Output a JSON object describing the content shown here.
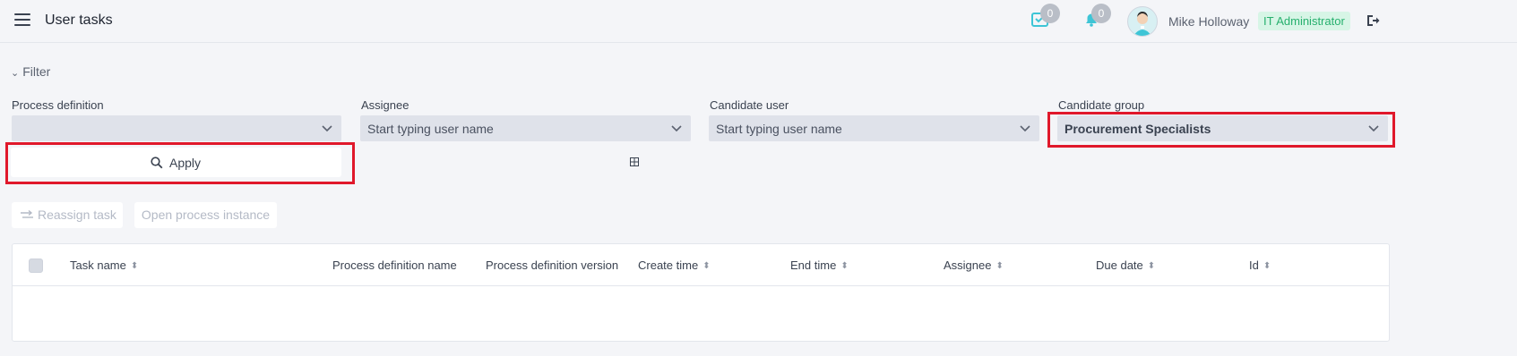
{
  "header": {
    "title": "User tasks",
    "tasks_count": "0",
    "notifications_count": "0",
    "user_name": "Mike Holloway",
    "role": "IT Administrator"
  },
  "filter": {
    "toggle_label": "Filter",
    "fields": [
      {
        "label": "Process definition",
        "value": "",
        "placeholder": ""
      },
      {
        "label": "Assignee",
        "value": "",
        "placeholder": "Start typing user name"
      },
      {
        "label": "Candidate user",
        "value": "",
        "placeholder": "Start typing user name"
      },
      {
        "label": "Candidate group",
        "value": "Procurement Specialists",
        "placeholder": ""
      }
    ],
    "apply_label": "Apply"
  },
  "actions": {
    "reassign_label": "Reassign task",
    "open_instance_label": "Open process instance"
  },
  "table": {
    "columns": [
      {
        "label": "Task name",
        "sortable": true
      },
      {
        "label": "Process definition name",
        "sortable": false
      },
      {
        "label": "Process definition version",
        "sortable": false
      },
      {
        "label": "Create time",
        "sortable": true
      },
      {
        "label": "End time",
        "sortable": true
      },
      {
        "label": "Assignee",
        "sortable": true
      },
      {
        "label": "Due date",
        "sortable": true
      },
      {
        "label": "Id",
        "sortable": true
      }
    ],
    "rows": []
  },
  "colors": {
    "accent": "#3ec5d6",
    "role_badge_bg": "#d7f5e6",
    "role_badge_text": "#27b06e",
    "highlight": "#e0182b"
  }
}
